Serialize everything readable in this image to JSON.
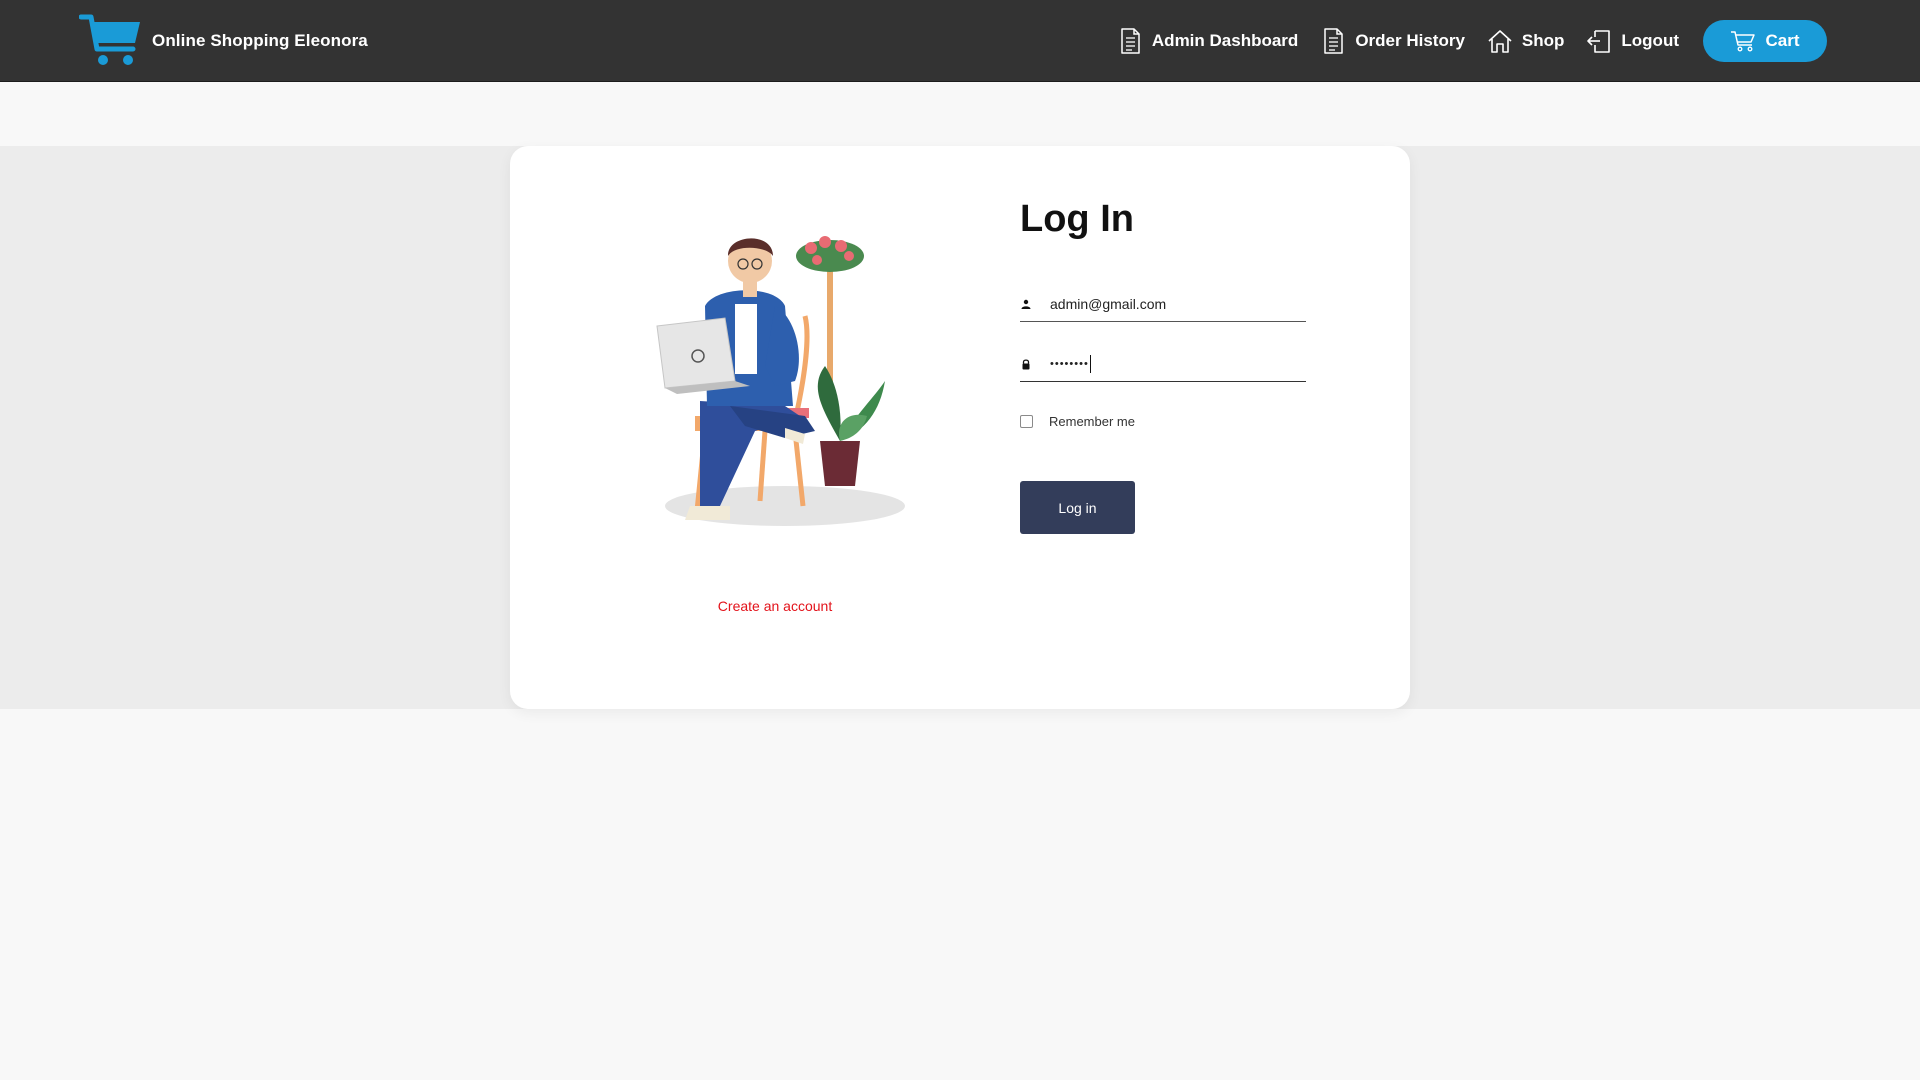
{
  "brand": {
    "name": "Online Shopping Eleonora",
    "logo_icon": "shopping-cart-icon",
    "logo_color": "#1a9bd7"
  },
  "nav": {
    "items": [
      {
        "label": "Admin Dashboard",
        "icon": "document-icon"
      },
      {
        "label": "Order History",
        "icon": "document-icon"
      },
      {
        "label": "Shop",
        "icon": "home-icon"
      },
      {
        "label": "Logout",
        "icon": "logout-icon"
      }
    ],
    "cart_label": "Cart",
    "cart_color": "#1a9bd7"
  },
  "login": {
    "title": "Log In",
    "email_value": "admin@gmail.com",
    "password_value": "••••••••",
    "remember_label": "Remember me",
    "remember_checked": false,
    "submit_label": "Log in",
    "submit_color": "#333d5a",
    "create_account_label": "Create an account",
    "create_account_color": "#e3131b"
  }
}
